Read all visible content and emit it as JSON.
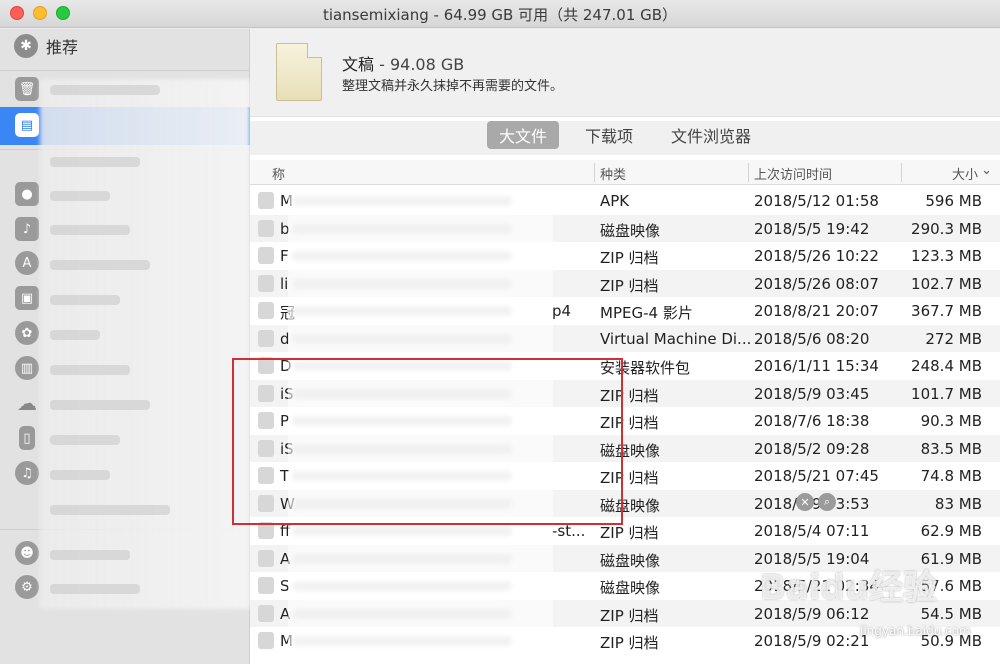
{
  "window": {
    "title": "tiansemixiang - 64.99 GB 可用（共 247.01 GB）"
  },
  "sidebar": {
    "recommend_label": "推荐",
    "icons": [
      "trash-icon",
      "document-icon",
      "messages-icon",
      "music-creation-icon",
      "app-store-icon",
      "photo-booth-icon",
      "photos-icon",
      "books-icon",
      "icloud-icon",
      "ios-device-icon",
      "itunes-icon",
      "users-icon",
      "system-icon"
    ]
  },
  "header": {
    "title": "文稿",
    "size": " - 94.08 GB",
    "description": "整理文稿并永久抹掉不再需要的文件。"
  },
  "tabs": [
    {
      "label": "大文件",
      "active": true
    },
    {
      "label": "下载项",
      "active": false
    },
    {
      "label": "文件浏览器",
      "active": false
    }
  ],
  "table": {
    "columns": {
      "name": "称",
      "type": "种类",
      "time": "上次访问时间",
      "size": "大小"
    },
    "rows": [
      {
        "name": "M",
        "type": "APK",
        "time": "2018/5/12 01:58",
        "size": "596 MB"
      },
      {
        "name": "b",
        "type": "磁盘映像",
        "time": "2018/5/5 19:42",
        "size": "290.3 MB"
      },
      {
        "name": "F",
        "type": "ZIP 归档",
        "time": "2018/5/26 10:22",
        "size": "123.3 MB"
      },
      {
        "name": "li",
        "type": "ZIP 归档",
        "time": "2018/5/26 08:07",
        "size": "102.7 MB"
      },
      {
        "name": "冠",
        "suffix": "p4",
        "type": "MPEG-4 影片",
        "time": "2018/8/21 20:07",
        "size": "367.7 MB"
      },
      {
        "name": "d",
        "type": "Virtual Machine Di...",
        "time": "2018/5/6 08:20",
        "size": "272 MB"
      },
      {
        "name": "D",
        "type": "安装器软件包",
        "time": "2016/1/11 15:34",
        "size": "248.4 MB"
      },
      {
        "name": "iS",
        "type": "ZIP 归档",
        "time": "2018/5/9 03:45",
        "size": "101.7 MB"
      },
      {
        "name": "P",
        "type": "ZIP 归档",
        "time": "2018/7/6 18:38",
        "size": "90.3 MB"
      },
      {
        "name": "iS",
        "type": "磁盘映像",
        "time": "2018/5/2 09:28",
        "size": "83.5 MB"
      },
      {
        "name": "T",
        "type": "ZIP 归档",
        "time": "2018/5/21 07:45",
        "size": "74.8 MB"
      },
      {
        "name": "W",
        "type": "磁盘映像",
        "time": "2018/5/9 03:53",
        "size": "83 MB"
      },
      {
        "name": "ff",
        "suffix": "-st...",
        "type": "ZIP 归档",
        "time": "2018/5/4 07:11",
        "size": "62.9 MB"
      },
      {
        "name": "A",
        "type": "磁盘映像",
        "time": "2018/5/5 19:04",
        "size": "61.9 MB"
      },
      {
        "name": "S",
        "type": "磁盘映像",
        "time": "2018/5/21 02:34",
        "size": "57.6 MB"
      },
      {
        "name": "A",
        "type": "ZIP 归档",
        "time": "2018/5/9 06:12",
        "size": "54.5 MB"
      },
      {
        "name": "M",
        "type": "ZIP 归档",
        "time": "2018/5/9 02:21",
        "size": "50.9 MB"
      }
    ]
  },
  "watermark": {
    "text": "Baidu经验",
    "url": "jingyan.baidu.com"
  },
  "colors": {
    "highlight": "#d22f35",
    "selection": "#3b86f5",
    "active_tab": "#a9a9a9"
  }
}
